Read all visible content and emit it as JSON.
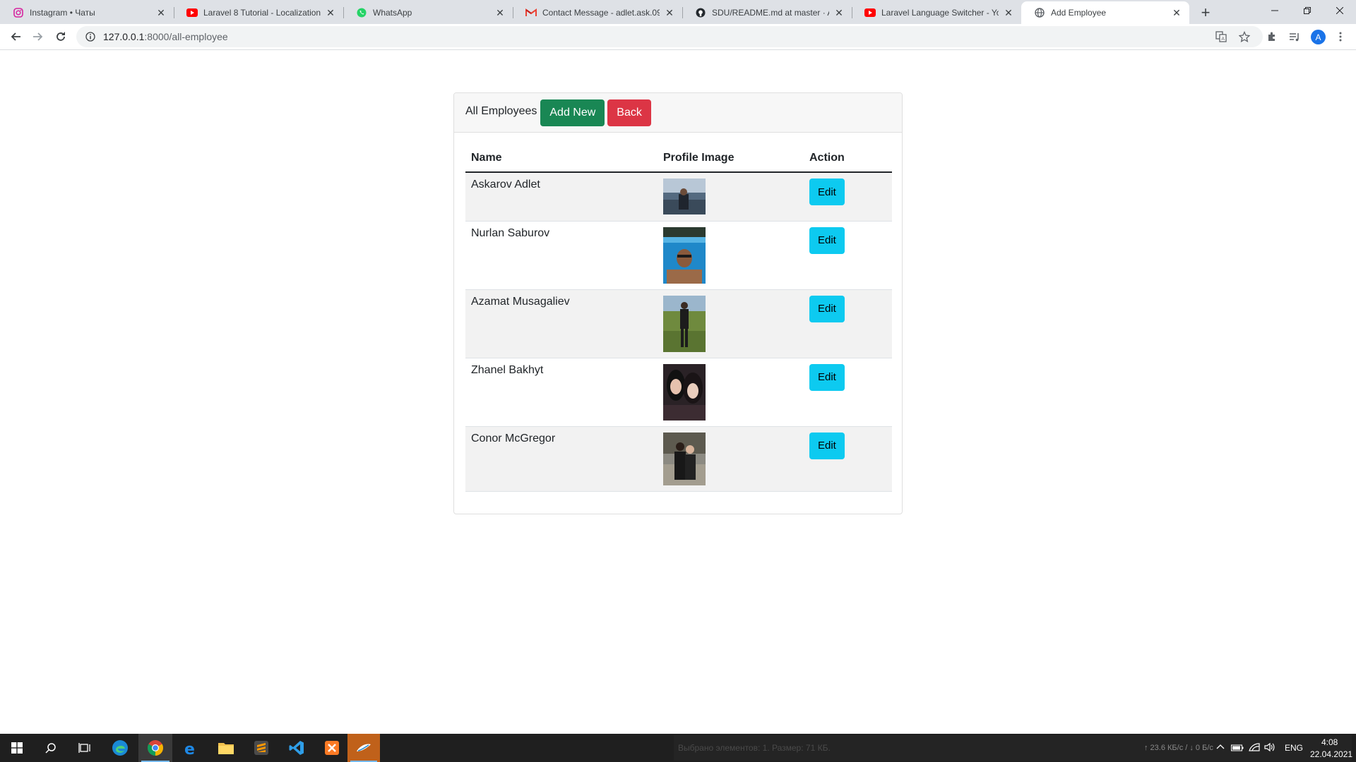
{
  "browser": {
    "tabs": [
      {
        "title": "Instagram • Чаты",
        "icon": "instagram-icon"
      },
      {
        "title": "Laravel 8 Tutorial - Localization -",
        "icon": "youtube-icon"
      },
      {
        "title": "WhatsApp",
        "icon": "whatsapp-icon"
      },
      {
        "title": "Contact Message - adlet.ask.09@",
        "icon": "gmail-icon"
      },
      {
        "title": "SDU/README.md at master · Ask",
        "icon": "github-icon"
      },
      {
        "title": "Laravel Language Switcher - YouT",
        "icon": "youtube-icon"
      },
      {
        "title": "Add Employee",
        "icon": "globe-icon"
      }
    ],
    "active_tab": 6,
    "url_host": "127.0.0.1",
    "url_path": ":8000/all-employee",
    "avatar_letter": "A"
  },
  "page": {
    "card_title": "All Employees",
    "add_new_label": "Add New",
    "back_label": "Back",
    "columns": [
      "Name",
      "Profile Image",
      "Action"
    ],
    "edit_label": "Edit",
    "rows": [
      {
        "name": "Askarov Adlet"
      },
      {
        "name": "Nurlan Saburov"
      },
      {
        "name": "Azamat Musagaliev"
      },
      {
        "name": "Zhanel Bakhyt"
      },
      {
        "name": "Conor McGregor"
      }
    ],
    "colors": {
      "success": "#198754",
      "danger": "#dc3545",
      "info": "#0dcaf0"
    }
  },
  "taskbar": {
    "status_text": "Выбрано элементов: 1. Размер: 71 КБ.",
    "network_speed": "↑ 23.6 КБ/с / ↓ 0 Б/с",
    "language": "ENG",
    "time": "4:08",
    "date": "22.04.2021"
  }
}
